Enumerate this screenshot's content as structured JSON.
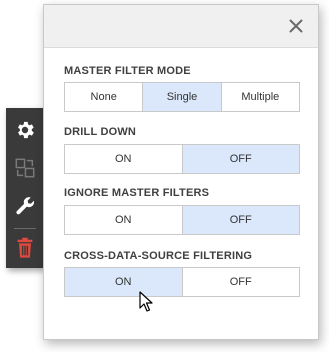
{
  "icons": {
    "settings": "gear-icon",
    "convert": "convert-icon",
    "edit": "wrench-icon",
    "delete": "trash-icon",
    "close": "close-icon",
    "cursor": "mouse-pointer-icon"
  },
  "colors": {
    "toolbar_bg": "#3a3a3a",
    "icon_white": "#ffffff",
    "icon_disabled": "#7a7a7a",
    "delete_red": "#e04a3f",
    "active_segment": "#dbe8fb",
    "header_bg": "#f0f0f0"
  },
  "sections": [
    {
      "label": "MASTER FILTER MODE",
      "options": [
        "None",
        "Single",
        "Multiple"
      ],
      "selected": "Single"
    },
    {
      "label": "DRILL DOWN",
      "options": [
        "ON",
        "OFF"
      ],
      "selected": "OFF"
    },
    {
      "label": "IGNORE MASTER FILTERS",
      "options": [
        "ON",
        "OFF"
      ],
      "selected": "OFF"
    },
    {
      "label": "CROSS-DATA-SOURCE FILTERING",
      "options": [
        "ON",
        "OFF"
      ],
      "selected": "ON"
    }
  ]
}
